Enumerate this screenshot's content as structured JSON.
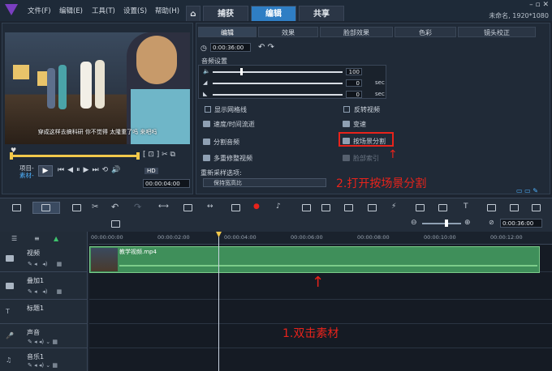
{
  "menu": {
    "items": [
      "文件(F)",
      "编辑(E)",
      "工具(T)",
      "设置(S)",
      "帮助(H)"
    ]
  },
  "tabs": {
    "home_icon": "home-icon",
    "capture": "捕获",
    "edit": "编辑",
    "share": "共享"
  },
  "status": {
    "text": "未命名, 1920*1080"
  },
  "preview": {
    "subtitle": "穿成这样去搞科研 你不觉得 太隆重了吗 来吧吗",
    "project_label": "项目-",
    "clip_label": "素材-",
    "timecode": "00:00:04:00",
    "quality": "HD"
  },
  "options": {
    "tabs": [
      "编辑",
      "效果",
      "脸部效果",
      "色彩",
      "镜头校正"
    ],
    "active_tab": "编辑",
    "time_value": "0:00:36:00",
    "audio_section": "音频设置",
    "volume": "100",
    "fade_in": "0",
    "fade_out": "0",
    "unit": "sec",
    "show_grid": "显示网格线",
    "reverse": "反转视频",
    "speed": "速度/时间流逝",
    "variable_speed": "变速",
    "split_audio": "分割音频",
    "split_by_scene": "按场景分割",
    "multi_trim": "多重修整视频",
    "face_index": "脸部索引",
    "resample_label": "重新采样选项:",
    "resample_value": "保持宽高比"
  },
  "timeline": {
    "zoom_time": "0:00:36:00",
    "ruler": [
      "00:00:00:00",
      "00:00:02:00",
      "00:00:04:00",
      "00:00:06:00",
      "00:00:08:00",
      "00:00:10:00",
      "00:00:12:00"
    ],
    "tracks": [
      "视频",
      "叠加1",
      "标题1",
      "声音",
      "音乐1"
    ],
    "clip_name": "教学视频.mp4"
  },
  "annotations": {
    "step1": "1.双击素材",
    "step2": "2.打开按场景分割"
  },
  "colors": {
    "accent": "#2f7ec4",
    "annotation": "#e8231b",
    "clip": "#3f8f5a"
  }
}
